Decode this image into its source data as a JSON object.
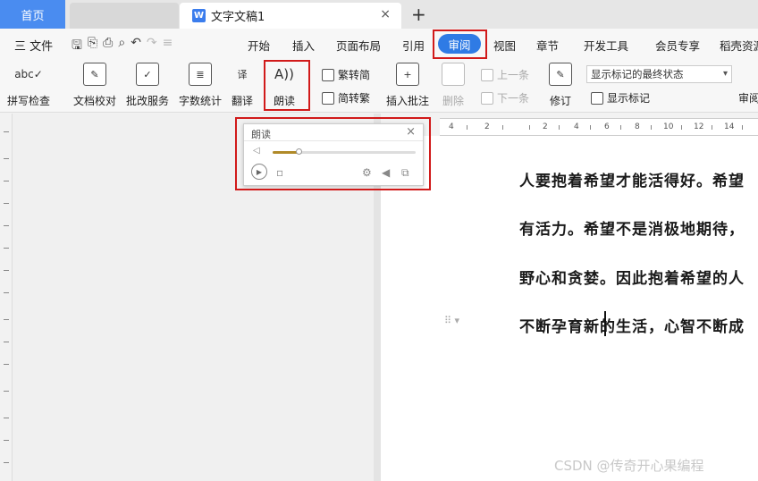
{
  "tabs": {
    "home": "首页",
    "document": "文字文稿1",
    "doc_icon_letter": "W"
  },
  "menubar": {
    "file": "三 文件",
    "items": [
      "开始",
      "插入",
      "页面布局",
      "引用",
      "视图",
      "章节",
      "开发工具",
      "会员专享",
      "稻壳资源"
    ],
    "active": "审阅"
  },
  "toolbar": {
    "spell_check": "拼写检查",
    "doc_proof": "文档校对",
    "revise_service": "批改服务",
    "word_count": "字数统计",
    "translate": "翻译",
    "read_aloud": "朗读",
    "simp_to_trad": "繁转简",
    "trad_to_simp": "简转繁",
    "insert_comment": "插入批注",
    "delete": "删除",
    "prev": "上一条",
    "next": "下一条",
    "track_changes": "修订",
    "display_state": "显示标记的最终状态",
    "show_markup": "显示标记",
    "review": "审阅"
  },
  "read_popup": {
    "title": "朗读",
    "close": "×",
    "volume_level": 0.18
  },
  "document": {
    "lines": [
      "人要抱着希望才能活得好。希望",
      "有活力。希望不是消极地期待，",
      "野心和贪婪。因此抱着希望的人",
      "不断孕育新的生活，心智不断成"
    ]
  },
  "ruler": [
    "4",
    "2",
    "2",
    "4",
    "6",
    "8",
    "10",
    "12",
    "14"
  ],
  "watermark": "CSDN @传奇开心果编程",
  "colors": {
    "accent": "#2f7be5",
    "highlight_box": "#d11a1a",
    "tab_home": "#4a8cf0"
  }
}
